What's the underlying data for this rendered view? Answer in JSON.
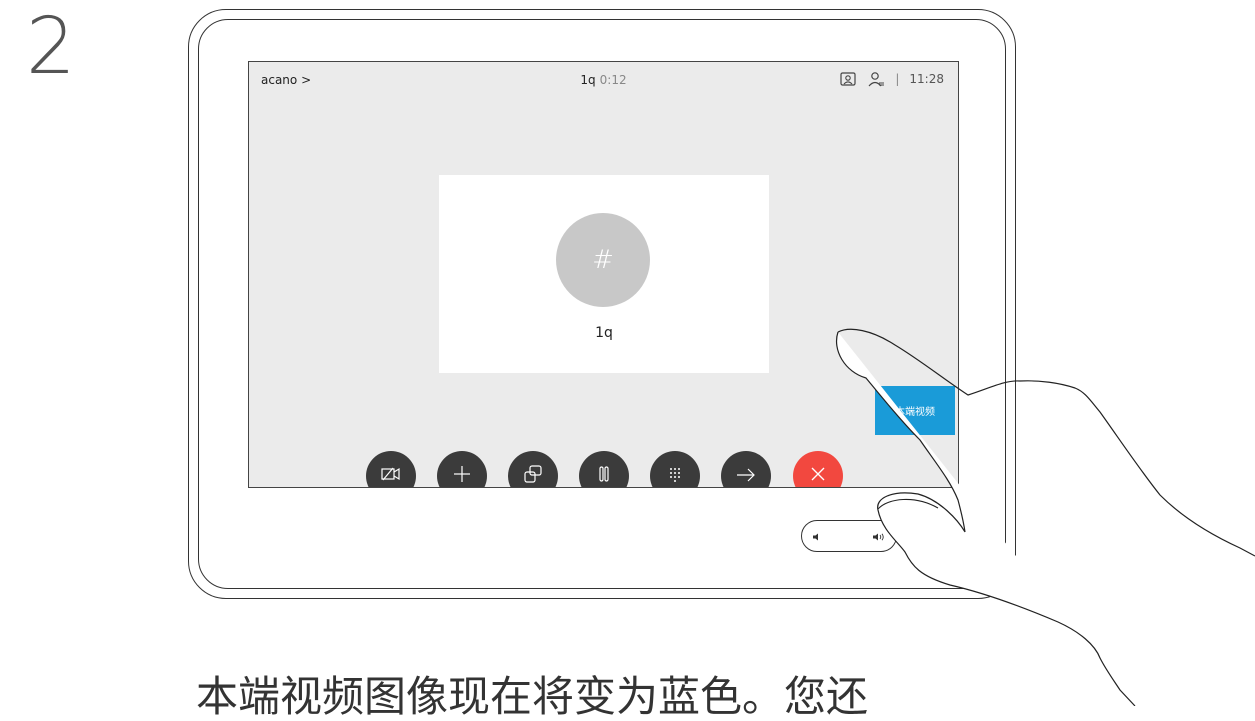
{
  "step": {
    "number": "2"
  },
  "topbar": {
    "call_name": "acano >",
    "title": "1q",
    "timer": "0:12",
    "clock": "11:28",
    "divider": "|"
  },
  "call": {
    "avatar_symbol": "#",
    "participant": "1q",
    "self_view_label": "本端视频"
  },
  "controls": [
    {
      "icon": "camera-off-icon"
    },
    {
      "icon": "plus-icon"
    },
    {
      "icon": "layout-icon"
    },
    {
      "icon": "hold-icon"
    },
    {
      "icon": "keypad-icon"
    },
    {
      "icon": "transfer-icon"
    },
    {
      "icon": "end-call-icon"
    }
  ],
  "colors": {
    "self_view": "#1a9bd8",
    "end_call": "#f2483f",
    "control": "#3b3b3b",
    "screen": "#ebebeb"
  },
  "caption": "本端视频图像现在将变为蓝色。您还"
}
